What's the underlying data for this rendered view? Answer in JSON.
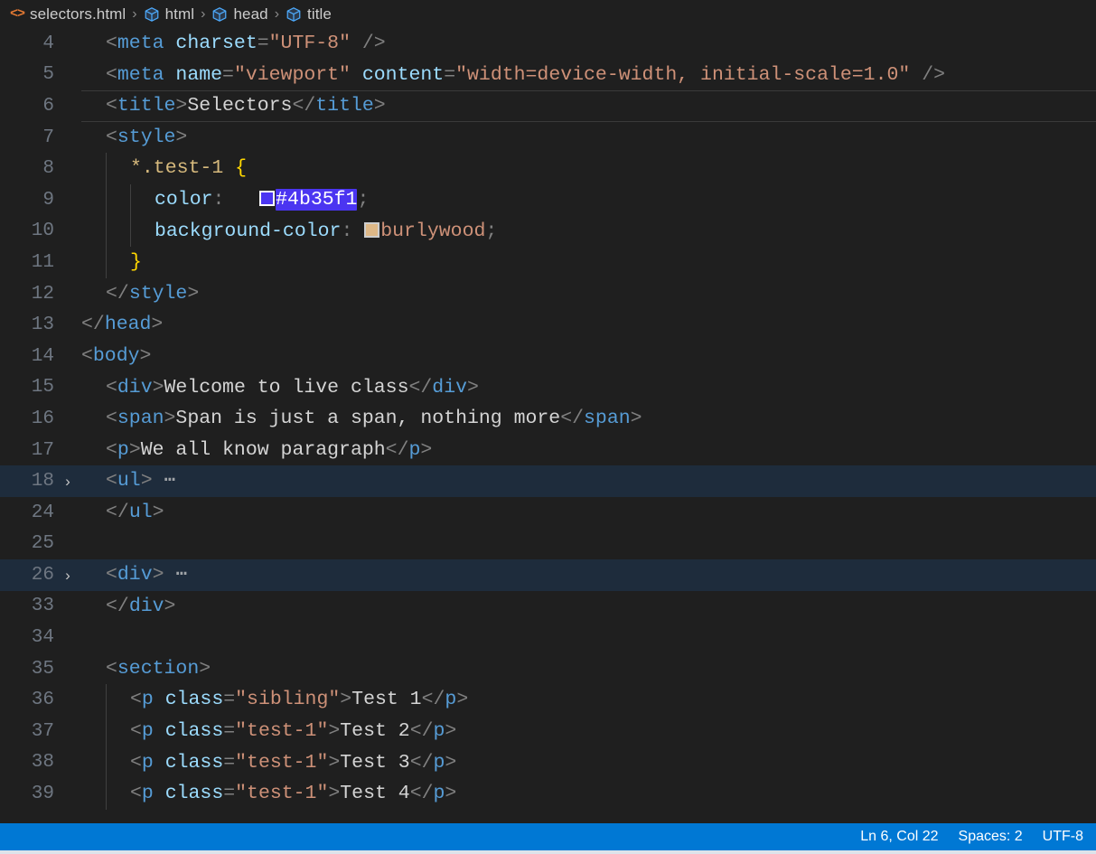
{
  "breadcrumb": {
    "separator": "›",
    "items": [
      {
        "label": "selectors.html",
        "icon": "html-file-icon",
        "icon_glyph": "<>"
      },
      {
        "label": "html",
        "icon": "symbol-cube-icon"
      },
      {
        "label": "head",
        "icon": "symbol-cube-icon"
      },
      {
        "label": "title",
        "icon": "symbol-cube-icon"
      }
    ]
  },
  "editor": {
    "language": "html",
    "fold_chevron": "›",
    "fold_ellipsis": "⋯",
    "current_line": 6,
    "colors": {
      "editor_background": "#1f1f1f",
      "folded_line_background": "#1e2c3c",
      "line_number": "#6e7681",
      "tag": "#569cd6",
      "attribute": "#9cdcfe",
      "string": "#ce9178",
      "punctuation": "#808080",
      "text": "#d4d4d4",
      "brace": "#ffd700",
      "selector": "#d7ba7d",
      "selection_highlight": "#4b35f1",
      "indent_guide": "#404040"
    },
    "lines": [
      {
        "n": 4,
        "indent": 1,
        "folded": false,
        "current": false,
        "text": "<meta charset=\"UTF-8\" />"
      },
      {
        "n": 5,
        "indent": 1,
        "folded": false,
        "current": false,
        "text": "<meta name=\"viewport\" content=\"width=device-width, initial-scale=1.0\" />"
      },
      {
        "n": 6,
        "indent": 1,
        "folded": false,
        "current": true,
        "text": "<title>Selectors</title>"
      },
      {
        "n": 7,
        "indent": 1,
        "folded": false,
        "current": false,
        "text": "<style>"
      },
      {
        "n": 8,
        "indent": 2,
        "folded": false,
        "current": false,
        "text": "*.test-1 {"
      },
      {
        "n": 9,
        "indent": 3,
        "folded": false,
        "current": false,
        "text": "color: #4b35f1;",
        "color_swatch": "#4b35f1",
        "highlighted_token": "#4b35f1"
      },
      {
        "n": 10,
        "indent": 3,
        "folded": false,
        "current": false,
        "text": "background-color: burlywood;",
        "color_swatch": "burlywood"
      },
      {
        "n": 11,
        "indent": 2,
        "folded": false,
        "current": false,
        "text": "}"
      },
      {
        "n": 12,
        "indent": 1,
        "folded": false,
        "current": false,
        "text": "</style>"
      },
      {
        "n": 13,
        "indent": 0,
        "folded": false,
        "current": false,
        "text": "</head>"
      },
      {
        "n": 14,
        "indent": 0,
        "folded": false,
        "current": false,
        "text": "<body>"
      },
      {
        "n": 15,
        "indent": 1,
        "folded": false,
        "current": false,
        "text": "<div>Welcome to live class</div>"
      },
      {
        "n": 16,
        "indent": 1,
        "folded": false,
        "current": false,
        "text": "<span>Span is just a span, nothing more</span>"
      },
      {
        "n": 17,
        "indent": 1,
        "folded": false,
        "current": false,
        "text": "<p>We all know paragraph</p>"
      },
      {
        "n": 18,
        "indent": 1,
        "folded": true,
        "current": false,
        "text": "<ul> ⋯"
      },
      {
        "n": 24,
        "indent": 1,
        "folded": false,
        "current": false,
        "text": "</ul>"
      },
      {
        "n": 25,
        "indent": 0,
        "folded": false,
        "current": false,
        "text": ""
      },
      {
        "n": 26,
        "indent": 1,
        "folded": true,
        "current": false,
        "text": "<div> ⋯"
      },
      {
        "n": 33,
        "indent": 1,
        "folded": false,
        "current": false,
        "text": "</div>"
      },
      {
        "n": 34,
        "indent": 0,
        "folded": false,
        "current": false,
        "text": ""
      },
      {
        "n": 35,
        "indent": 1,
        "folded": false,
        "current": false,
        "text": "<section>"
      },
      {
        "n": 36,
        "indent": 2,
        "folded": false,
        "current": false,
        "text": "<p class=\"sibling\">Test 1</p>"
      },
      {
        "n": 37,
        "indent": 2,
        "folded": false,
        "current": false,
        "text": "<p class=\"test-1\">Test 2</p>"
      },
      {
        "n": 38,
        "indent": 2,
        "folded": false,
        "current": false,
        "text": "<p class=\"test-1\">Test 3</p>"
      },
      {
        "n": 39,
        "indent": 2,
        "folded": false,
        "current": false,
        "text": "<p class=\"test-1\">Test 4</p>"
      }
    ]
  },
  "status_bar": {
    "background": "#0078d4",
    "cursor_position": "Ln 6, Col 22",
    "indentation": "Spaces: 2",
    "encoding": "UTF-8"
  }
}
